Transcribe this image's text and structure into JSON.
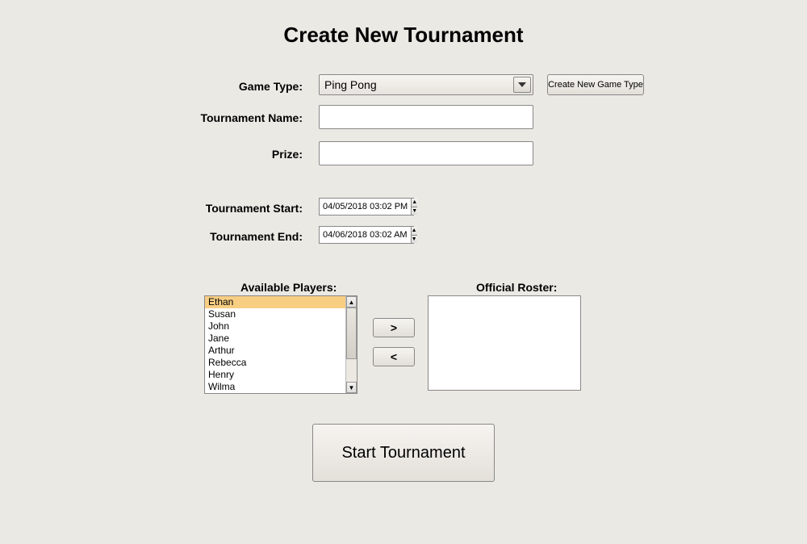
{
  "title": "Create New Tournament",
  "labels": {
    "game_type": "Game Type:",
    "tournament_name": "Tournament Name:",
    "prize": "Prize:",
    "tournament_start": "Tournament Start:",
    "tournament_end": "Tournament End:",
    "available_players": "Available Players:",
    "official_roster": "Official Roster:"
  },
  "game_type": {
    "selected": "Ping Pong"
  },
  "buttons": {
    "create_game_type": "Create New Game Type",
    "move_right": ">",
    "move_left": "<",
    "start_tournament": "Start Tournament"
  },
  "fields": {
    "tournament_name": "",
    "prize": ""
  },
  "tournament_start": "04/05/2018 03:02 PM",
  "tournament_end": "04/06/2018 03:02 AM",
  "available_players": [
    "Ethan",
    "Susan",
    "John",
    "Jane",
    "Arthur",
    "Rebecca",
    "Henry",
    "Wilma"
  ],
  "selected_available_index": 0,
  "official_roster": []
}
